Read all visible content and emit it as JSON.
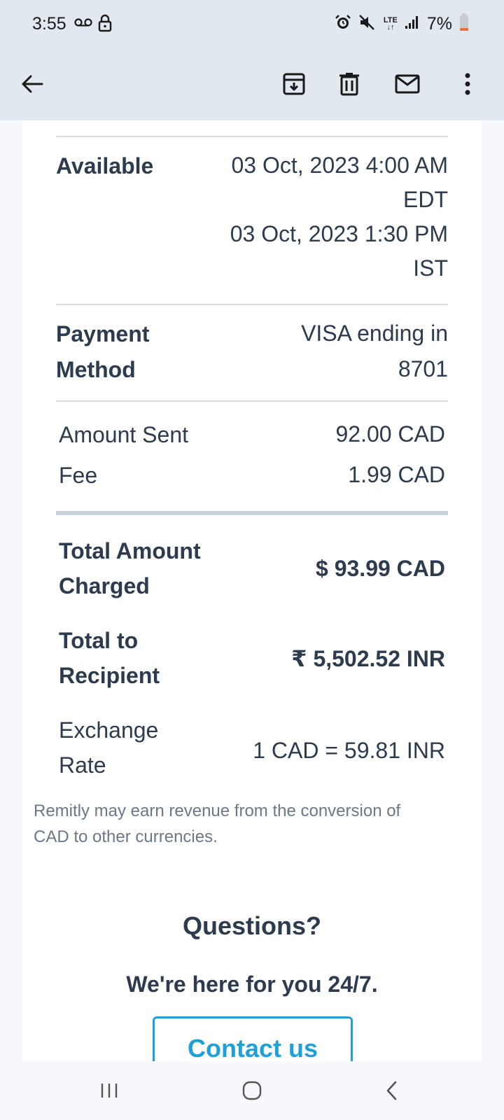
{
  "status_bar": {
    "time": "3:55",
    "lte": "LTE",
    "battery_percent": "7%"
  },
  "app_bar": {
    "icons": [
      "back-arrow-icon",
      "archive-icon",
      "delete-icon",
      "mark-unread-icon",
      "more-options-icon"
    ]
  },
  "details": {
    "available": {
      "label": "Available",
      "line1": "03 Oct, 2023 4:00 AM",
      "line2": "EDT",
      "line3": "03 Oct, 2023 1:30 PM",
      "line4": "IST"
    },
    "payment_method": {
      "label_line1": "Payment",
      "label_line2": "Method",
      "value_line1": "VISA ending in",
      "value_line2": "8701"
    },
    "amount_sent": {
      "label": "Amount Sent",
      "value": "92.00 CAD"
    },
    "fee": {
      "label": "Fee",
      "value": "1.99 CAD"
    },
    "total_charged": {
      "label_line1": "Total Amount",
      "label_line2": "Charged",
      "value": "$ 93.99 CAD"
    },
    "total_recipient": {
      "label_line1": "Total to",
      "label_line2": "Recipient",
      "value": "₹ 5,502.52 INR"
    },
    "exchange_rate": {
      "label_line1": "Exchange",
      "label_line2": "Rate",
      "value": "1 CAD = 59.81 INR"
    },
    "disclaimer": "Remitly may earn revenue from the conversion of CAD to other currencies."
  },
  "questions": {
    "title": "Questions?",
    "subtitle": "We're here for you 24/7.",
    "button_label": "Contact us"
  },
  "colors": {
    "accent": "#1ea1d8",
    "text": "#2c3b4d",
    "muted": "#6b7889",
    "chrome": "#e2e8ef"
  }
}
